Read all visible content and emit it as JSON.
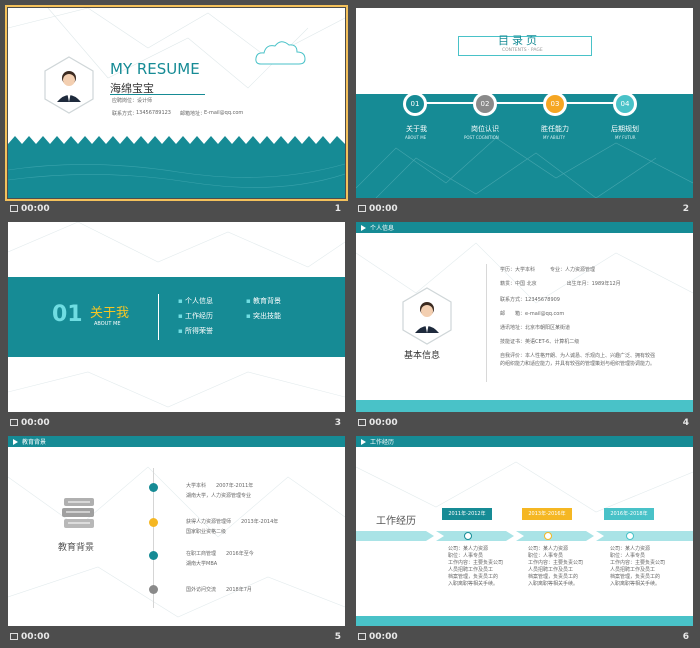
{
  "slides": [
    {
      "time": "00:00",
      "num": "1",
      "title": "MY RESUME",
      "name": "海绵宝宝",
      "position": "应聘岗位：设计师",
      "contact_label": "联系方式：",
      "contact": "13456789123",
      "email_label": "邮箱地址：",
      "email": "E-mail@qq.com"
    },
    {
      "time": "00:00",
      "num": "2",
      "title": "目录页",
      "subtitle": "CONTENTS · PAGE",
      "items": [
        {
          "no": "01",
          "cn": "关于我",
          "en": "ABOUT ME"
        },
        {
          "no": "02",
          "cn": "岗位认识",
          "en": "POST COGNITION"
        },
        {
          "no": "03",
          "cn": "胜任能力",
          "en": "MY ABILITY"
        },
        {
          "no": "04",
          "cn": "后期规划",
          "en": "MY FUTUR"
        }
      ]
    },
    {
      "time": "00:00",
      "num": "3",
      "no": "01",
      "title": "关于我",
      "en": "ABOUT ME",
      "items": [
        "个人信息",
        "教育背景",
        "工作经历",
        "突出技能",
        "所得荣誉"
      ]
    },
    {
      "time": "00:00",
      "num": "4",
      "tag": "个人信息",
      "heading": "基本信息",
      "lines": [
        "学历：大学本科　　　专业：人力资源管理",
        "籍贯：中国 北京　　　　　　出生年月：1989年12月",
        "联系方式：12345678909",
        "邮　　箱：e-mail@qq.com",
        "通讯地址：北京市朝阳区某街道",
        "技能证书：英语CET-6、计算机二级",
        "自我评价：本人性格开朗、为人诚恳、乐观向上、兴趣广泛、拥有较强的组织能力和适应能力，并具有较强的管理策划与组织管理协调能力。"
      ]
    },
    {
      "time": "00:00",
      "num": "5",
      "tag": "教育背景",
      "heading": "教育背景",
      "entries": [
        {
          "a": "大学本科　　2007年-2011年",
          "b": "湖南大学，人力资源管理专业"
        },
        {
          "a": "获得人力资源管理师　　2013年-2014年",
          "b": "国家职业资格二级"
        },
        {
          "a": "在职工商管理　　2016年至今",
          "b": "湖南大学MBA"
        },
        {
          "a": "国外访问交流　　2018年7月",
          "b": ""
        }
      ]
    },
    {
      "time": "00:00",
      "num": "6",
      "tag": "工作经历",
      "heading": "工作经历",
      "periods": [
        "2011年-2012年",
        "2013年-2016年",
        "2016年-2018年"
      ],
      "detail": [
        "公司：某人力资源",
        "职位：人事专员",
        "工作内容：主要负责公司",
        "人员招聘工作及员工",
        "档案管理，负责员工的",
        "入职离职等相关手续。"
      ]
    }
  ],
  "colors": {
    "teal": "#168b95",
    "cyan": "#49c2c8",
    "yellow": "#f5b723",
    "gray": "#8a8a8a"
  }
}
